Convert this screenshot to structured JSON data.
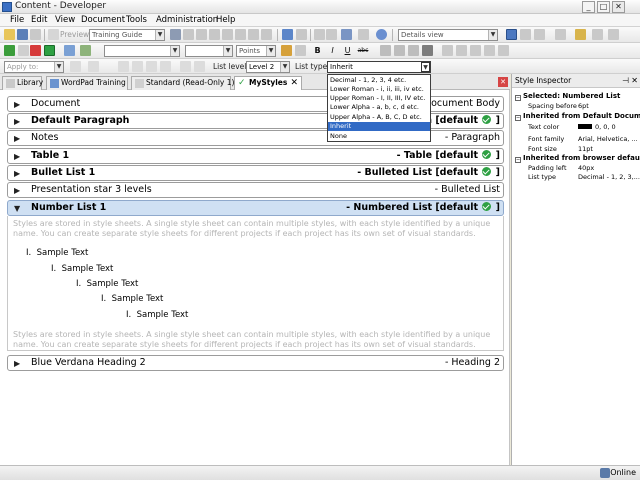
{
  "window": {
    "title": "Content - Developer",
    "min": "_",
    "max": "□",
    "close": "✕"
  },
  "menu": [
    "File",
    "Edit",
    "View",
    "Document",
    "Tools",
    "Administration",
    "Help"
  ],
  "toolbar": {
    "preview_label": "Preview",
    "project_combo": "Training Guide",
    "view_combo": "Details view",
    "font_size_combo": "Points",
    "bold": "B",
    "italic": "I",
    "underline": "U",
    "strike": "abc",
    "apply_to_label": "Apply to:",
    "list_level_label": "List level:",
    "list_level_value": "Level 2",
    "list_type_label": "List type:",
    "list_type_value": "Inherit"
  },
  "tabs": [
    {
      "label": "Library",
      "icon": "library-icon"
    },
    {
      "label": "WordPad Training",
      "icon": "wordpad-icon"
    },
    {
      "label": "Standard (Read-Only 1)",
      "icon": "document-icon"
    },
    {
      "label": "MyStyles",
      "icon": "check-icon",
      "active": true,
      "close": "✕"
    }
  ],
  "styles": [
    {
      "name": "Document",
      "type": "- Document Body",
      "bold": false
    },
    {
      "name": "Default Paragraph",
      "type": "- Paragraph [default",
      "bold": true,
      "default": true
    },
    {
      "name": "Notes",
      "type": "- Paragraph",
      "bold": false
    },
    {
      "name": "Table 1",
      "type": "- Table [default",
      "bold": true,
      "default": true
    },
    {
      "name": "Bullet List 1",
      "type": "- Bulleted List [default",
      "bold": true,
      "default": true
    },
    {
      "name": "Presentation star 3 levels",
      "type": "- Bulleted List",
      "bold": false
    },
    {
      "name": "Number List 1",
      "type": "- Numbered List [default",
      "bold": true,
      "default": true,
      "expanded": true
    },
    {
      "name": "Blue Verdana Heading 2",
      "type": "- Heading 2",
      "bold": false
    }
  ],
  "row_close": "]",
  "preview": {
    "paragraph": "Styles are stored in style sheets. A single style sheet can contain multiple styles, with each style identified by a unique name. You can create separate style sheets for different projects if each project has its own set of visual standards.",
    "items": [
      {
        "marker": "I.",
        "text": "Sample Text"
      },
      {
        "marker": "I.",
        "text": "Sample Text"
      },
      {
        "marker": "I.",
        "text": "Sample Text"
      },
      {
        "marker": "I.",
        "text": "Sample Text"
      },
      {
        "marker": "I.",
        "text": "Sample Text"
      }
    ]
  },
  "list_type_options": [
    "Decimal - 1, 2, 3, 4 etc.",
    "Lower Roman - i, ii, iii, iv etc.",
    "Upper Roman - I, II, III, IV etc.",
    "Lower Alpha - a, b, c, d etc.",
    "Upper Alpha - A, B, C, D etc.",
    "Inherit",
    "None"
  ],
  "list_type_selected_index": 5,
  "inspector": {
    "title": "Style Inspector",
    "pin": "⊣",
    "close": "✕",
    "selected_header": "Selected: Numbered List",
    "selected_props": [
      {
        "name": "Spacing before",
        "value": "6pt"
      }
    ],
    "default_header": "Inherited from Default Document",
    "default_props": [
      {
        "name": "Text color",
        "value": "0, 0, 0"
      },
      {
        "name": "Font family",
        "value": "Arial, Helvetica, ..."
      },
      {
        "name": "Font size",
        "value": "11pt"
      }
    ],
    "browser_header": "Inherited from browser defaults",
    "browser_props": [
      {
        "name": "Padding left",
        "value": "40px"
      },
      {
        "name": "List type",
        "value": "Decimal - 1, 2, 3,..."
      }
    ]
  },
  "status": {
    "online": "Online"
  },
  "colors": {
    "accent": "#316ac5",
    "expanded_row": "#cfe0f3",
    "check": "#2ea043"
  }
}
